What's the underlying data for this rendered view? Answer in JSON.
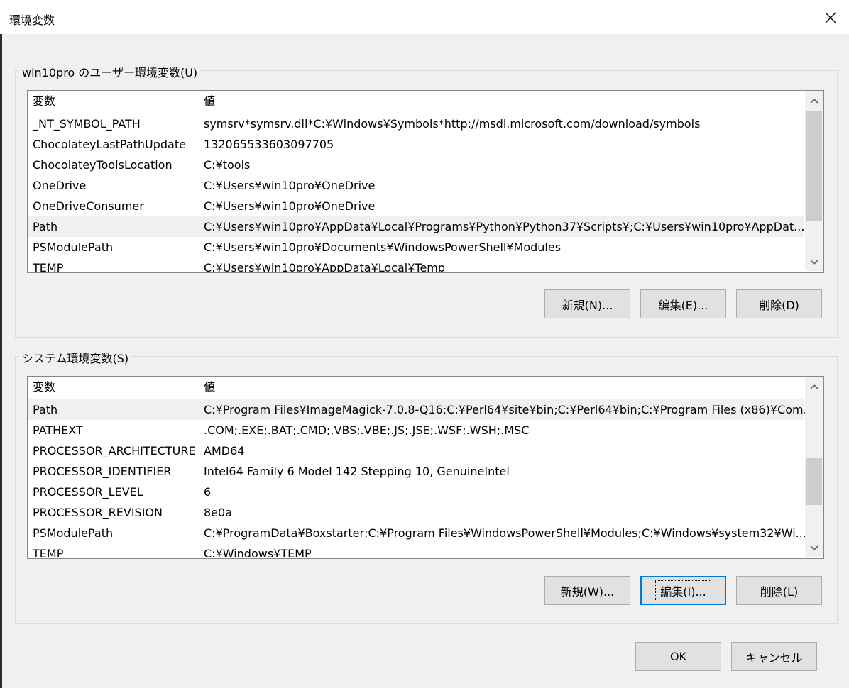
{
  "window": {
    "title": "環境変数"
  },
  "user_group": {
    "legend": "win10pro のユーザー環境変数(U)",
    "columns": [
      "変数",
      "値"
    ],
    "rows": [
      {
        "name": "_NT_SYMBOL_PATH",
        "value": "symsrv*symsrv.dll*C:¥Windows¥Symbols*http://msdl.microsoft.com/download/symbols"
      },
      {
        "name": "ChocolateyLastPathUpdate",
        "value": "132065533603097705"
      },
      {
        "name": "ChocolateyToolsLocation",
        "value": "C:¥tools"
      },
      {
        "name": "OneDrive",
        "value": "C:¥Users¥win10pro¥OneDrive"
      },
      {
        "name": "OneDriveConsumer",
        "value": "C:¥Users¥win10pro¥OneDrive"
      },
      {
        "name": "Path",
        "value": "C:¥Users¥win10pro¥AppData¥Local¥Programs¥Python¥Python37¥Scripts¥;C:¥Users¥win10pro¥AppDat..."
      },
      {
        "name": "PSModulePath",
        "value": "C:¥Users¥win10pro¥Documents¥WindowsPowerShell¥Modules"
      },
      {
        "name": "TEMP",
        "value": "C:¥Users¥win10pro¥AppData¥Local¥Temp"
      }
    ],
    "buttons": {
      "new": "新規(N)...",
      "edit": "編集(E)...",
      "delete": "削除(D)"
    }
  },
  "system_group": {
    "legend": "システム環境変数(S)",
    "columns": [
      "変数",
      "値"
    ],
    "rows": [
      {
        "name": "Path",
        "value": "C:¥Program Files¥ImageMagick-7.0.8-Q16;C:¥Perl64¥site¥bin;C:¥Perl64¥bin;C:¥Program Files (x86)¥Com..."
      },
      {
        "name": "PATHEXT",
        "value": ".COM;.EXE;.BAT;.CMD;.VBS;.VBE;.JS;.JSE;.WSF;.WSH;.MSC"
      },
      {
        "name": "PROCESSOR_ARCHITECTURE",
        "value": "AMD64"
      },
      {
        "name": "PROCESSOR_IDENTIFIER",
        "value": "Intel64 Family 6 Model 142 Stepping 10, GenuineIntel"
      },
      {
        "name": "PROCESSOR_LEVEL",
        "value": "6"
      },
      {
        "name": "PROCESSOR_REVISION",
        "value": "8e0a"
      },
      {
        "name": "PSModulePath",
        "value": "C:¥ProgramData¥Boxstarter;C:¥Program Files¥WindowsPowerShell¥Modules;C:¥Windows¥system32¥Wi..."
      },
      {
        "name": "TEMP",
        "value": "C:¥Windows¥TEMP"
      }
    ],
    "buttons": {
      "new": "新規(W)...",
      "edit": "編集(I)...",
      "delete": "削除(L)"
    }
  },
  "footer": {
    "ok": "OK",
    "cancel": "キャンセル"
  },
  "icons": {
    "close": "close-icon",
    "scroll_up": "chevron-up-icon",
    "scroll_down": "chevron-down-icon"
  },
  "colors": {
    "focus_border": "#0078d7",
    "selected_row": "#f0f0f0"
  }
}
